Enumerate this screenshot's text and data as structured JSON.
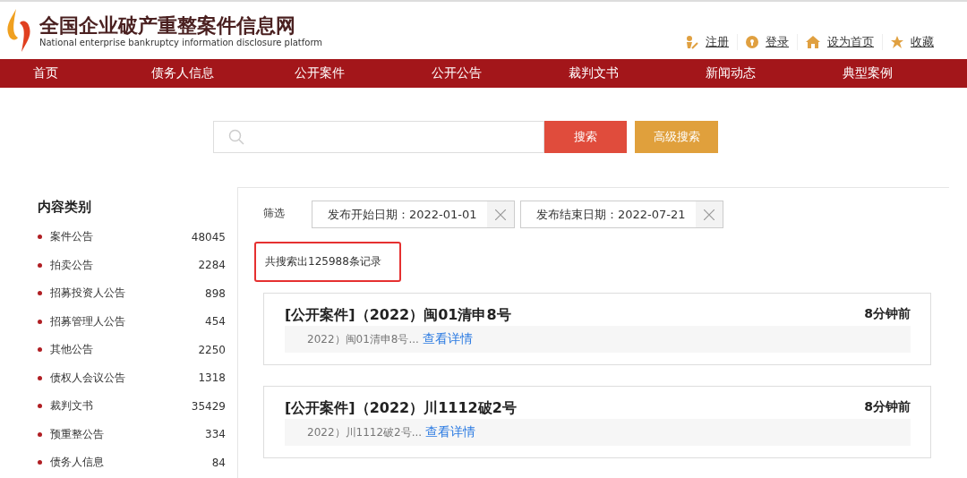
{
  "header": {
    "site_title": "全国企业破产重整案件信息网",
    "site_subtitle": "National enterprise bankruptcy  information disclosure platform",
    "links": [
      {
        "kind": "register",
        "label": "注册"
      },
      {
        "kind": "login",
        "label": "登录"
      },
      {
        "kind": "home",
        "label": "设为首页"
      },
      {
        "kind": "favorite",
        "label": "收藏"
      }
    ]
  },
  "nav": [
    "首页",
    "债务人信息",
    "公开案件",
    "公开公告",
    "裁判文书",
    "新闻动态",
    "典型案例"
  ],
  "search": {
    "button": "搜索",
    "advanced_button": "高级搜索"
  },
  "sidebar": {
    "title": "内容类别",
    "items": [
      {
        "label": "案件公告",
        "count": "48045"
      },
      {
        "label": "拍卖公告",
        "count": "2284"
      },
      {
        "label": "招募投资人公告",
        "count": "898"
      },
      {
        "label": "招募管理人公告",
        "count": "454"
      },
      {
        "label": "其他公告",
        "count": "2250"
      },
      {
        "label": "债权人会议公告",
        "count": "1318"
      },
      {
        "label": "裁判文书",
        "count": "35429"
      },
      {
        "label": "预重整公告",
        "count": "334"
      },
      {
        "label": "债务人信息",
        "count": "84"
      }
    ]
  },
  "filter": {
    "label": "筛选",
    "chips": [
      "发布开始日期：2022-01-01",
      "发布结束日期：2022-07-21"
    ]
  },
  "result_count": "共搜索出125988条记录",
  "results": [
    {
      "title": "[公开案件]（2022）闽01清申8号",
      "time": "8分钟前",
      "snippet": "2022）闽01清申8号...",
      "link": "查看详情"
    },
    {
      "title": "[公开案件]（2022）川1112破2号",
      "time": "8分钟前",
      "snippet": "2022）川1112破2号...",
      "link": "查看详情"
    }
  ]
}
